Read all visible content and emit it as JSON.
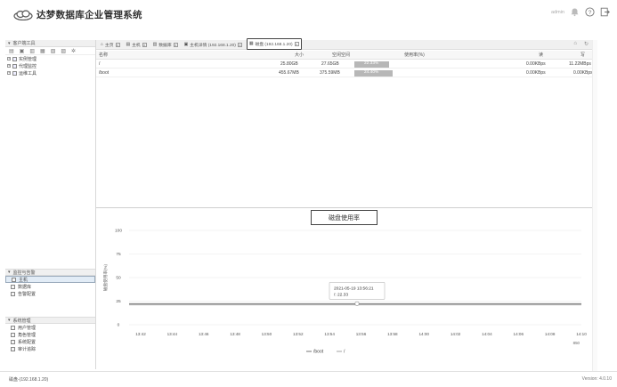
{
  "app": {
    "title": "达梦数据库企业管理系统",
    "user": "admin"
  },
  "icons": {
    "logo": "cloud-logo-icon",
    "bell": "bell-icon",
    "help": "help-icon",
    "logout": "logout-icon"
  },
  "sidebar": {
    "header": "客户端工具",
    "tree": [
      {
        "label": "实例管理"
      },
      {
        "label": "代理监控"
      },
      {
        "label": "运维工具"
      }
    ],
    "monitor": {
      "header": "监控与告警",
      "items": [
        "主机",
        "数据库",
        "告警配置"
      ]
    },
    "system": {
      "header": "系统管理",
      "items": [
        "用户管理",
        "角色管理",
        "系统配置",
        "审计追踪"
      ]
    }
  },
  "tabs": [
    {
      "label": "主页"
    },
    {
      "label": "主机"
    },
    {
      "label": "数据库"
    },
    {
      "label": "主机详情 (192.168.1.20)"
    },
    {
      "label": "磁盘 (192.168.1.20)"
    }
  ],
  "table": {
    "headers": {
      "name": "名称",
      "size": "大小",
      "free": "空闲空间",
      "usage": "使用率(%)",
      "read": "读",
      "write": "写"
    },
    "rows": [
      {
        "name": "/",
        "size": "25.80GB",
        "free": "27.65GB",
        "usage": "22.33%",
        "usage_value": 22.33,
        "read": "0.00KBps",
        "write": "11.22MBps"
      },
      {
        "name": "/boot",
        "size": "455.67MB",
        "free": "375.59MB",
        "usage": "24.40%",
        "usage_value": 24.4,
        "read": "0.00KBps",
        "write": "0.00KBps"
      }
    ]
  },
  "chart_data": {
    "type": "line",
    "title": "磁盘使用率",
    "ylabel": "磁盘使用率(%)",
    "xlabel": "",
    "ylim": [
      0,
      100
    ],
    "yticks": [
      "100",
      "75",
      "50",
      "25",
      "0"
    ],
    "categories": [
      "13:42",
      "13:44",
      "13:46",
      "13:48",
      "13:50",
      "13:52",
      "13:54",
      "13:56",
      "13:58",
      "14:00",
      "14:02",
      "14:04",
      "14:06",
      "14:08",
      "14:10"
    ],
    "series": [
      {
        "name": "/boot",
        "color": "#666666",
        "values": [
          22.3,
          22.3,
          22.3,
          22.3,
          22.3,
          22.3,
          22.3,
          22.3,
          22.3,
          22.3,
          22.3,
          22.3,
          22.3,
          22.3,
          22.3,
          22.3
        ]
      },
      {
        "name": "/",
        "color": "#999999",
        "values": [
          22.33,
          22.33,
          22.33,
          22.33,
          22.33,
          22.33,
          22.33,
          22.33,
          22.33,
          22.33,
          22.33,
          22.33,
          22.33,
          22.33,
          22.33,
          22.33
        ]
      }
    ],
    "tooltip": {
      "time": "2021-05-19 13:56:21",
      "text": "/: 22.33"
    },
    "corner": "850",
    "legend_position": "bottom"
  },
  "status": {
    "left": "磁盘-(192.168.1.20)",
    "right": "Version: 4.0.10"
  }
}
